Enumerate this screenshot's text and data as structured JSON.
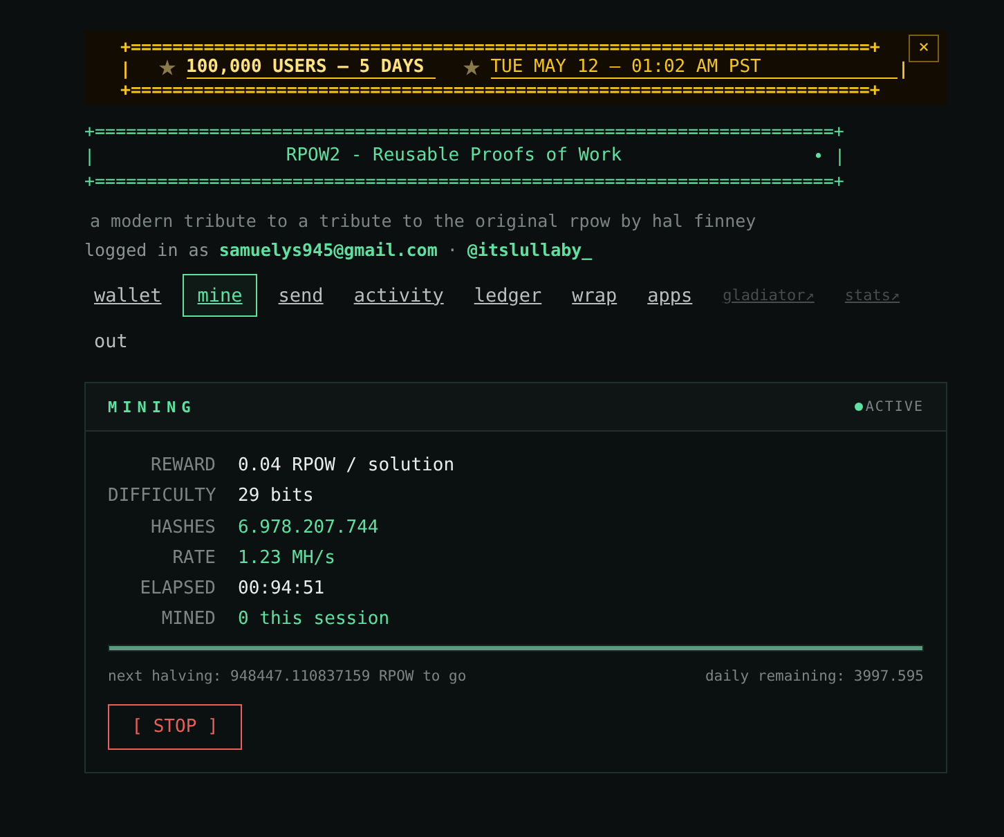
{
  "banner": {
    "rule_top": "+=======================================================================+",
    "edge_left": "|",
    "headline": "100,000 USERS — 5 DAYS",
    "datetime": "TUE MAY 12 — 01:02 AM PST",
    "edge_right": "|",
    "rule_bottom": "+=======================================================================+",
    "close": "×"
  },
  "header": {
    "rule_top": "+=======================================================================+",
    "edge_left": "|",
    "title": "RPOW2 - Reusable Proofs of Work",
    "dot": "•",
    "edge_right": "|",
    "rule_bottom": "+=======================================================================+"
  },
  "tagline": "a modern tribute to a tribute to the original rpow by hal finney",
  "login": {
    "prefix": "logged in as",
    "email": "samuelys945@gmail.com",
    "separator": "·",
    "handle": "@itslullaby_"
  },
  "nav": [
    {
      "label": "wallet",
      "selected": false,
      "disabled": false
    },
    {
      "label": "mine",
      "selected": true,
      "disabled": false
    },
    {
      "label": "send",
      "selected": false,
      "disabled": false
    },
    {
      "label": "activity",
      "selected": false,
      "disabled": false
    },
    {
      "label": "ledger",
      "selected": false,
      "disabled": false
    },
    {
      "label": "wrap",
      "selected": false,
      "disabled": false
    },
    {
      "label": "apps",
      "selected": false,
      "disabled": false
    },
    {
      "label": "gladiator↗",
      "selected": false,
      "disabled": true,
      "plain": false
    },
    {
      "label": "stats↗",
      "selected": false,
      "disabled": true,
      "plain": false
    },
    {
      "label": "out",
      "selected": false,
      "disabled": false,
      "plain": true
    }
  ],
  "panel": {
    "title": "MINING",
    "status": {
      "label": "ACTIVE",
      "color": "#5ee0a0"
    },
    "stats": [
      {
        "label": "REWARD",
        "value": "0.04 RPOW / solution",
        "highlight": false
      },
      {
        "label": "DIFFICULTY",
        "value": "29 bits",
        "highlight": false
      },
      {
        "label": "HASHES",
        "value": "6.978.207.744",
        "highlight": true
      },
      {
        "label": "RATE",
        "value": "1.23 MH/s",
        "highlight": true
      },
      {
        "label": "ELAPSED",
        "value": "00:94:51",
        "highlight": false
      },
      {
        "label": "MINED",
        "value": "0 this session",
        "highlight": true
      }
    ],
    "progress": {
      "level": 1
    },
    "next_halving": "next halving: 948447.110837159 RPOW to go",
    "daily_remaining": "daily remaining: 3997.595",
    "stop_button": "[ STOP ]"
  }
}
